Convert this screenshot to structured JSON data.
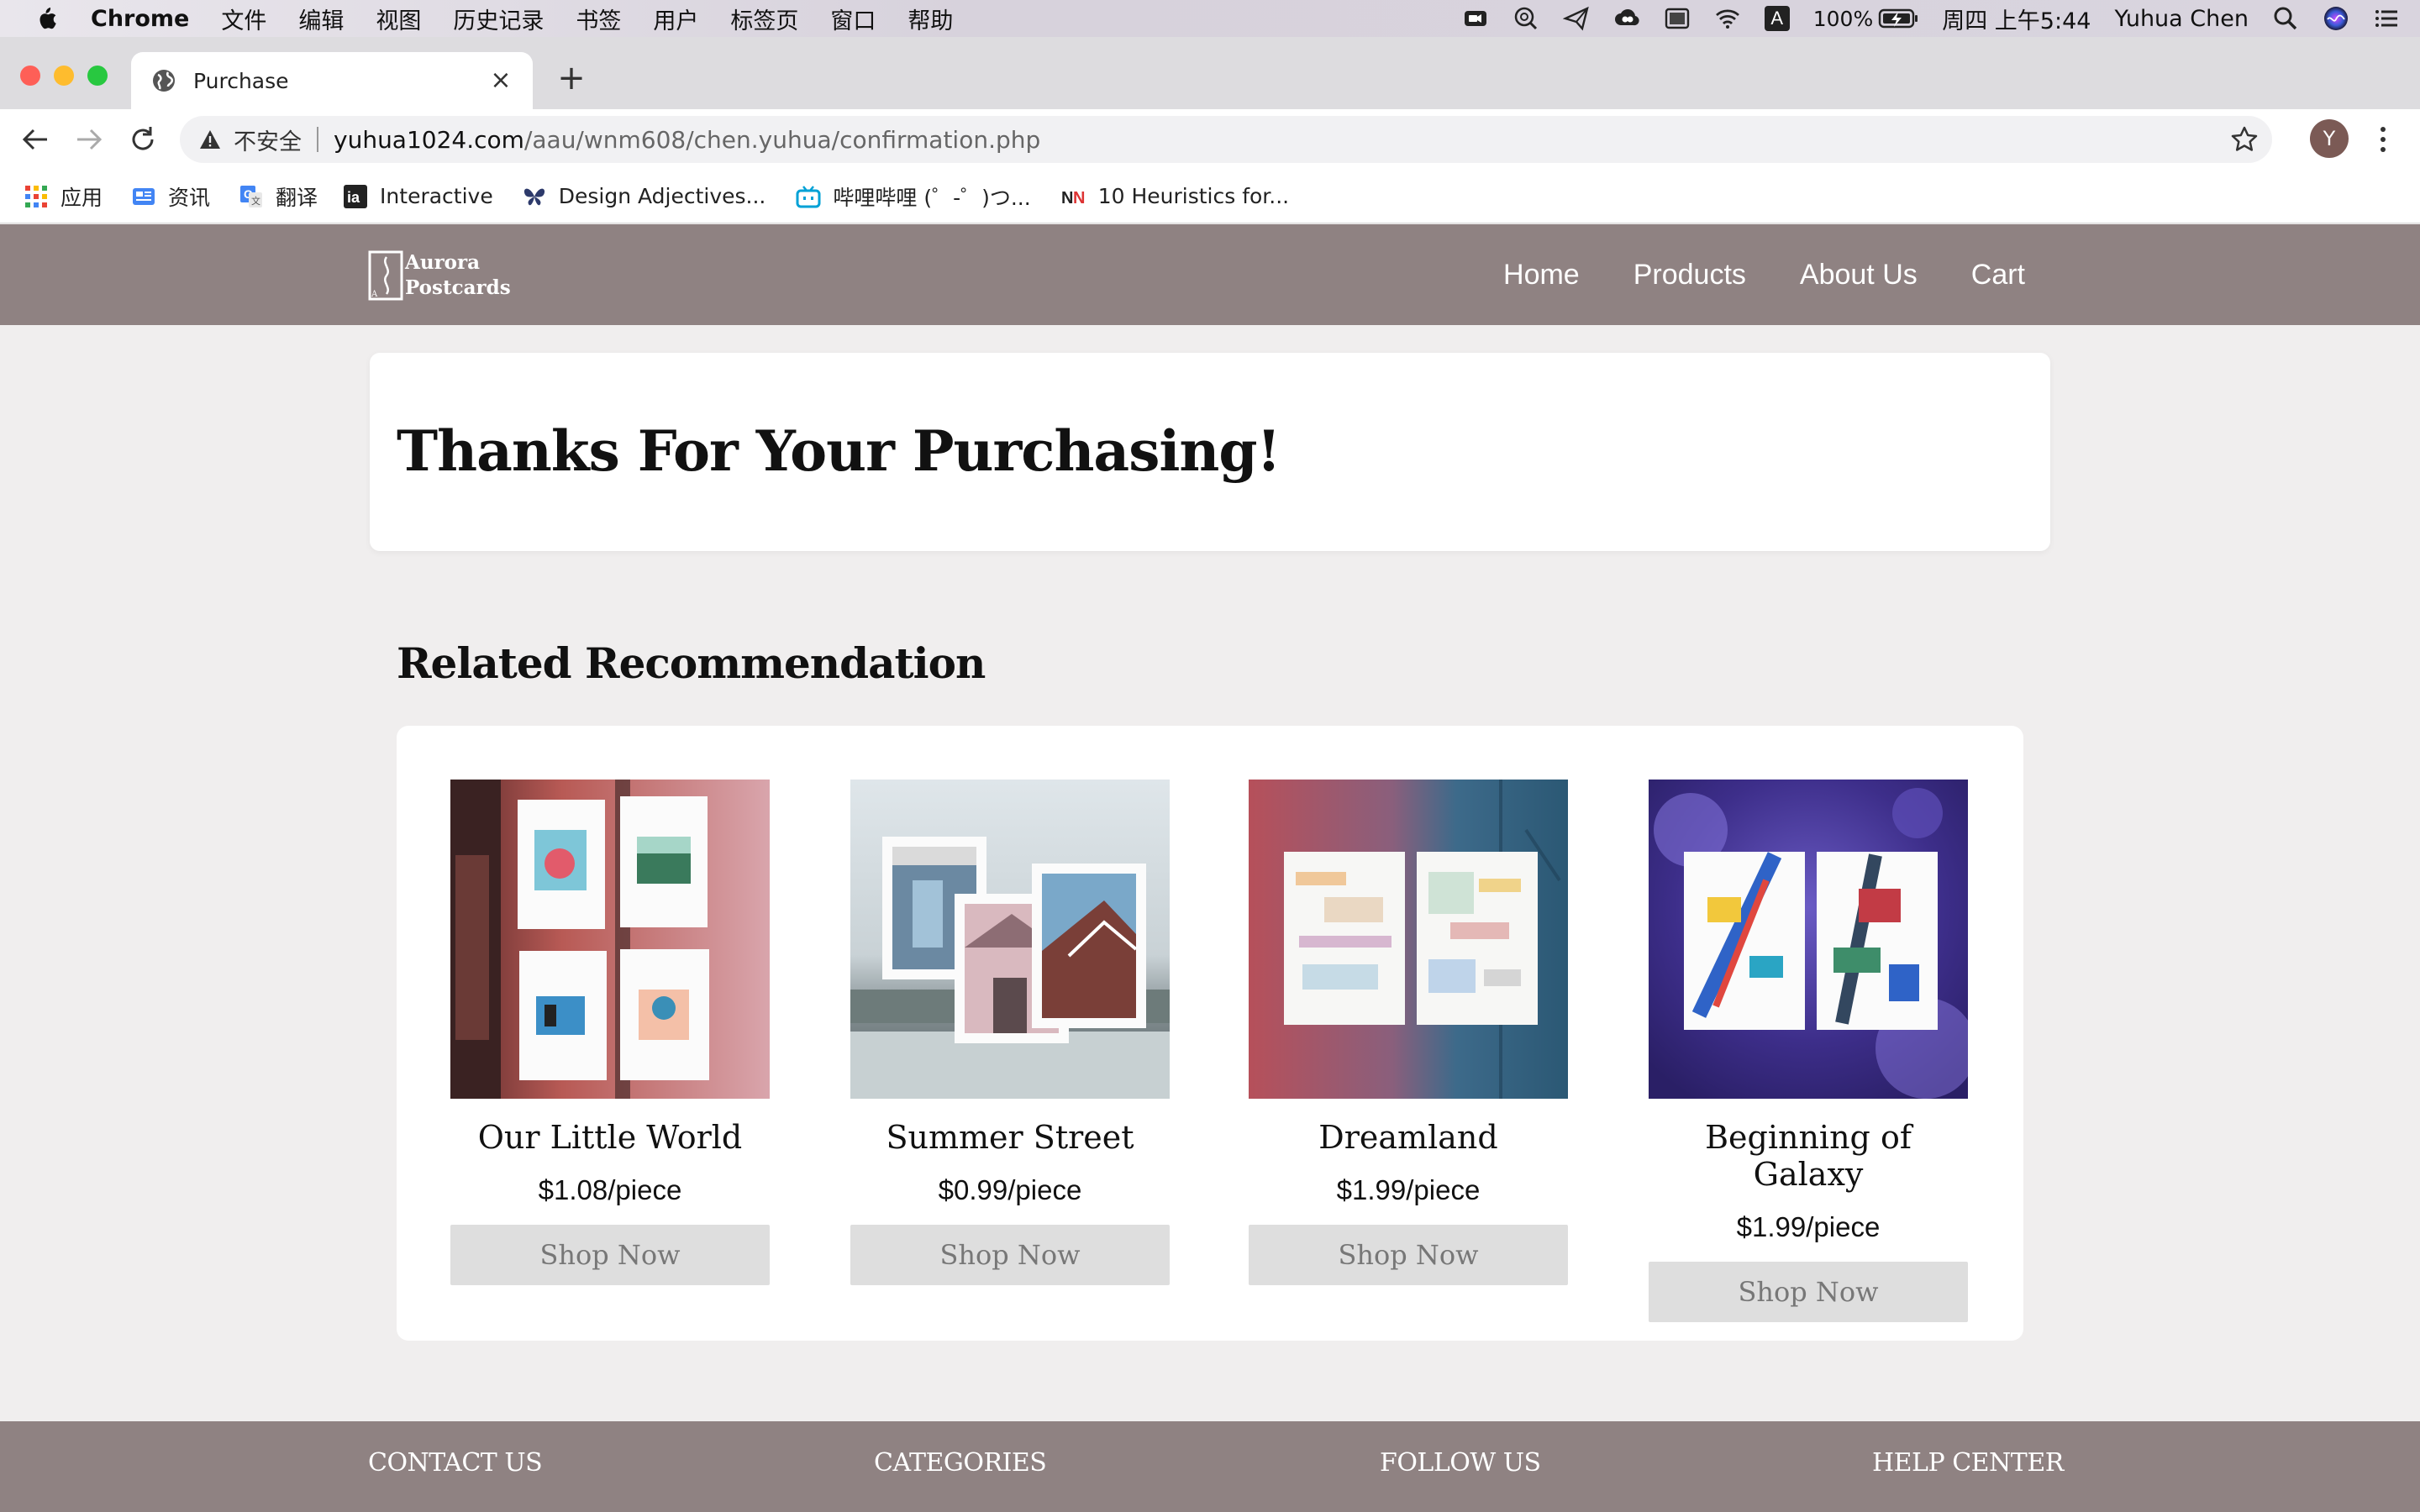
{
  "menubar": {
    "app_name": "Chrome",
    "menus": [
      "文件",
      "编辑",
      "视图",
      "历史记录",
      "书签",
      "用户",
      "标签页",
      "窗口",
      "帮助"
    ],
    "battery": "100%",
    "clock": "周四 上午5:44",
    "user": "Yuhua Chen",
    "input_source": "A"
  },
  "browser": {
    "tab_title": "Purchase",
    "new_tab_label": "+",
    "close_label": "×",
    "not_secure_label": "不安全",
    "url_host": "yuhua1024.com",
    "url_path": "/aau/wnm608/chen.yuhua/confirmation.php",
    "avatar_initial": "Y",
    "bookmarks": [
      {
        "label": "应用",
        "icon": "apps-grid-icon"
      },
      {
        "label": "资讯",
        "icon": "news-icon"
      },
      {
        "label": "翻译",
        "icon": "translate-icon"
      },
      {
        "label": "Interactive",
        "icon": "interactive-icon"
      },
      {
        "label": "Design Adjectives...",
        "icon": "butterfly-icon"
      },
      {
        "label": "哔哩哔哩 (゜-゜)つ...",
        "icon": "bilibili-icon"
      },
      {
        "label": "10 Heuristics for...",
        "icon": "nn-icon"
      }
    ]
  },
  "site": {
    "logo_line1": "Aurora",
    "logo_line2": "Postcards",
    "nav": [
      "Home",
      "Products",
      "About Us",
      "Cart"
    ],
    "thanks_title": "Thanks For Your Purchasing!",
    "related_title": "Related Recommendation",
    "products": [
      {
        "name": "Our Little World",
        "price": "$1.08/piece",
        "button": "Shop Now"
      },
      {
        "name": "Summer Street",
        "price": "$0.99/piece",
        "button": "Shop Now"
      },
      {
        "name": "Dreamland",
        "price": "$1.99/piece",
        "button": "Shop Now"
      },
      {
        "name": "Beginning of Galaxy",
        "price": "$1.99/piece",
        "button": "Shop Now"
      }
    ],
    "footer_headings": [
      "CONTACT US",
      "CATEGORIES",
      "FOLLOW US",
      "HELP CENTER"
    ]
  },
  "colors": {
    "header_bg": "#8f8282",
    "page_bg": "#f0eeee",
    "button_bg": "#dedede",
    "button_text": "#777777"
  }
}
